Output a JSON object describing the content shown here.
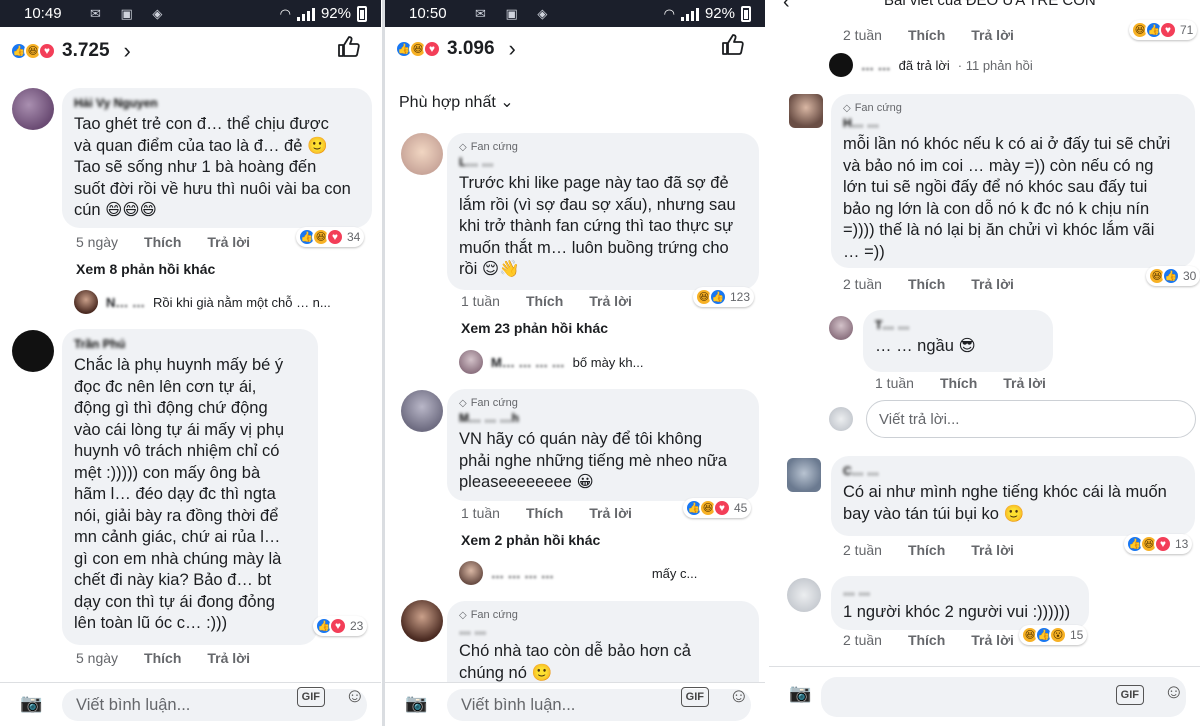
{
  "colors": {
    "accent": "#1877f2",
    "bubble": "#f0f2f5",
    "muted": "#65676b"
  },
  "panel1": {
    "status": {
      "time": "10:49",
      "battery": "92%"
    },
    "reactions": {
      "count": "3.725"
    },
    "comments": [
      {
        "name": "Hải Vy Nguyen",
        "text": "Tao ghét trẻ con đ… thể chịu được\nvà quan điểm của tao là đ… đẻ 🙂\nTao sẽ sống như 1 bà hoàng đến\nsuốt đời rồi về hưu thì nuôi vài ba con\ncún 😄😄😄",
        "time": "5 ngày",
        "like": "Thích",
        "reply": "Trả lời",
        "reactions": "34",
        "more": "Xem 8 phản hồi khác",
        "last_reply_name": "N… …",
        "last_reply_text": "Rồi khi già nằm một chỗ … n..."
      },
      {
        "name": "Trần Phú",
        "text": "Chắc là phụ huynh mấy bé ý\nđọc đc nên lên cơn tự ái,\nđộng gì thì động chứ động\nvào cái lòng tự ái mấy vị phụ\nhuynh vô trách nhiệm chỉ có\nmệt :))))) con mấy ông bà\nhãm l… đéo dạy đc thì ngta\nnói, giải bày ra đồng thời để\nmn cảnh giác, chứ ai rủa l…\ngì con em nhà chúng mày là\nchết đi này kia? Bảo đ… bt\ndạy con thì tự ái đong đỏng\nlên toàn lũ óc c… :)))",
        "time": "5 ngày",
        "like": "Thích",
        "reply": "Trả lời",
        "reactions": "23"
      }
    ],
    "composer": {
      "placeholder": "Viết bình luận...",
      "gif": "GIF"
    }
  },
  "panel2": {
    "status": {
      "time": "10:50",
      "battery": "92%"
    },
    "reactions": {
      "count": "3.096"
    },
    "sort_label": "Phù hợp nhất",
    "comments": [
      {
        "badge": "Fan cứng",
        "name": "L… …",
        "text": "Trước khi like page này tao đã sợ đẻ\nlắm rồi (vì sợ đau sợ xấu), nhưng sau\nkhi trở thành fan cứng thì tao thực sự\nmuốn thắt m… luôn buồng trứng cho\nrồi 😌👋",
        "time": "1 tuần",
        "like": "Thích",
        "reply": "Trả lời",
        "reactions": "123",
        "more": "Xem 23 phản hồi khác",
        "last_reply_name": "M… … … …",
        "last_reply_text": "bố mày kh..."
      },
      {
        "badge": "Fan cứng",
        "name": "M… … …h",
        "text": "VN hãy có quán này để tôi không\nphải nghe những tiếng mè nheo nữa\npleaseeeeeeee 😀",
        "time": "1 tuần",
        "like": "Thích",
        "reply": "Trả lời",
        "reactions": "45",
        "more": "Xem 2 phản hồi khác",
        "last_reply_name": "… … … …",
        "last_reply_text": "mấy c..."
      },
      {
        "badge": "Fan cứng",
        "name": "… …",
        "text": "Chó nhà tao còn dễ bảo hơn cả\nchúng nó 🙂"
      }
    ],
    "composer": {
      "placeholder": "Viết bình luận...",
      "gif": "GIF"
    }
  },
  "panel3": {
    "title": "Bài viết của ĐẺO ƯA TRẺ CON",
    "top_meta": {
      "time": "2 tuần",
      "like": "Thích",
      "reply": "Trả lời",
      "reactions": "71"
    },
    "reply_summary": {
      "name": "… …",
      "verb": "đã trả lời",
      "count": "· 11 phản hồi"
    },
    "comments": [
      {
        "badge": "Fan cứng",
        "name": "H… …",
        "text": "mỗi lần nó khóc nếu k có ai ở đấy tui sẽ chửi\nvà bảo nó im coi … mày =)) còn nếu có ng\nlớn tui sẽ ngồi đấy để nó khóc sau đấy tui\nbảo ng lớn là con dỗ nó k đc nó k chịu nín\n=)))) thế là nó lại bị ăn chửi vì khóc lắm vãi\n… =))",
        "time": "2 tuần",
        "like": "Thích",
        "reply": "Trả lời",
        "reactions": "30"
      },
      {
        "name": "T… …",
        "text": "… … ngầu 😎",
        "time": "1 tuần",
        "like": "Thích",
        "reply": "Trả lời"
      },
      {
        "name": "C… …",
        "text": "Có ai như mình nghe tiếng khóc cái là muốn\nbay vào tán túi bụi ko 🙂",
        "time": "2 tuần",
        "like": "Thích",
        "reply": "Trả lời",
        "reactions": "13"
      },
      {
        "name": "… …",
        "text": "1 người khóc 2 người vui :))))))",
        "time": "2 tuần",
        "like": "Thích",
        "reply": "Trả lời",
        "reactions": "15"
      }
    ],
    "write_reply": "Viết trả lời...",
    "composer": {
      "gif": "GIF"
    }
  }
}
